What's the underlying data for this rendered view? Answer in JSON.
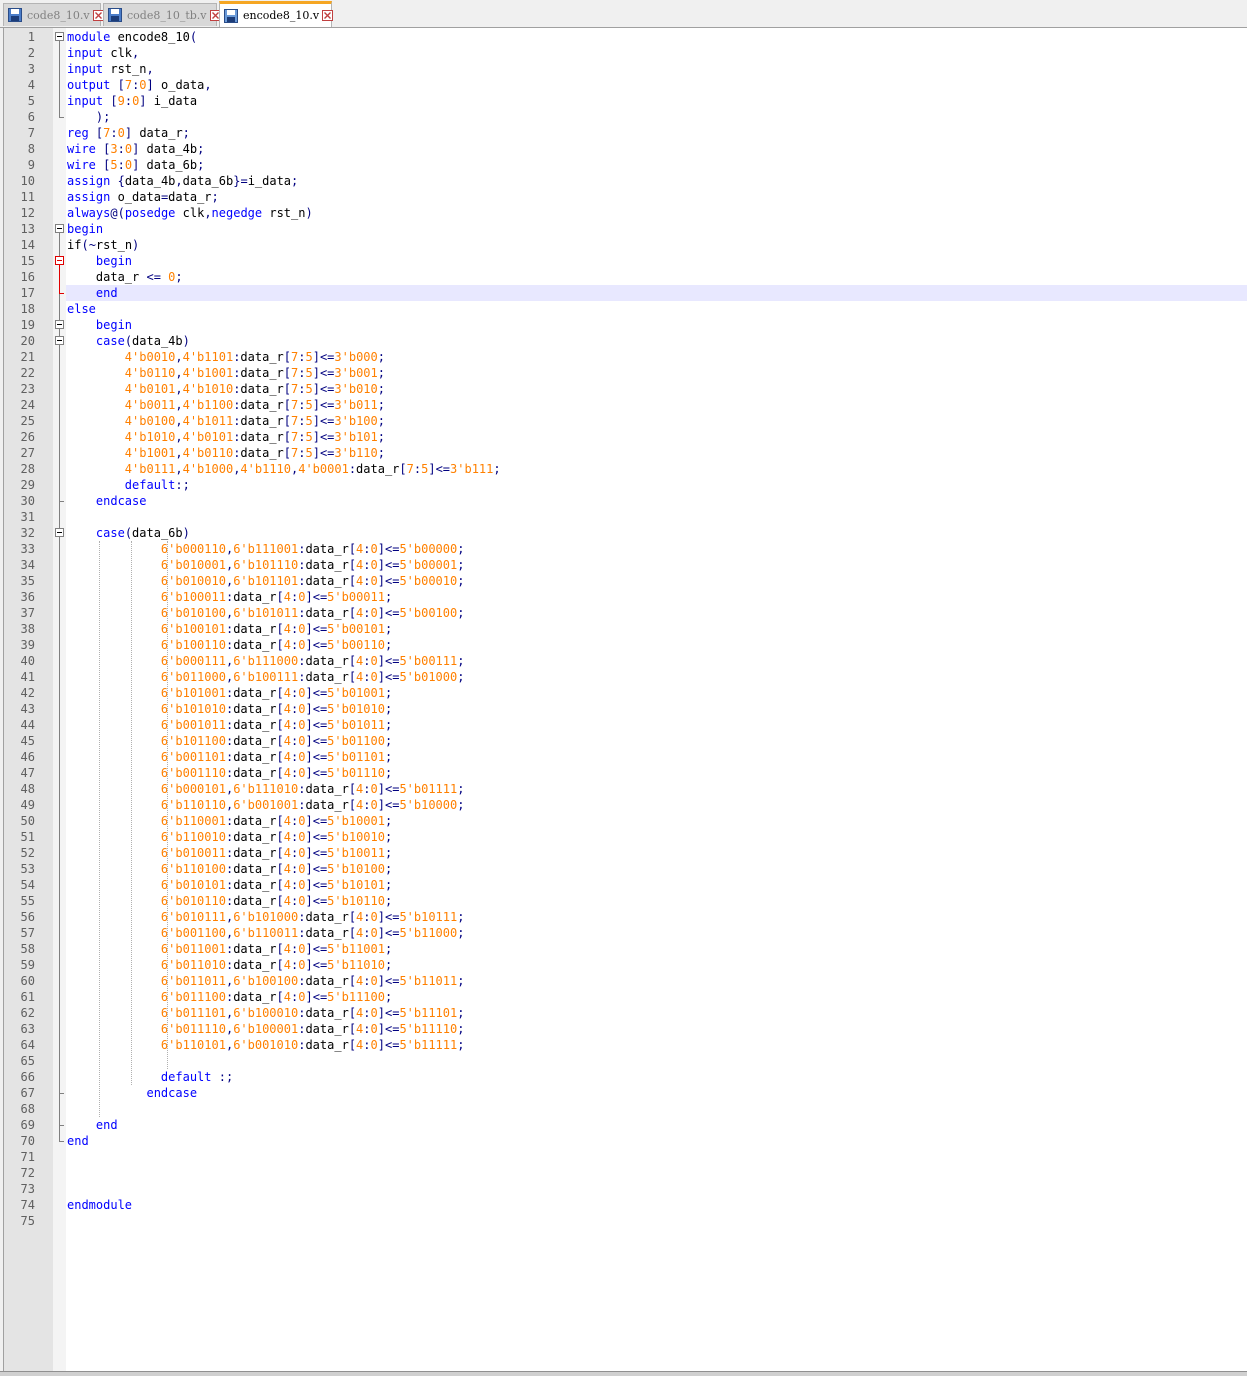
{
  "tabs": [
    {
      "label": "code8_10.v",
      "active": false
    },
    {
      "label": "code8_10_tb.v",
      "active": false
    },
    {
      "label": "encode8_10.v",
      "active": true
    }
  ],
  "editor": {
    "highlighted_line": 17,
    "lines": [
      "module encode8_10(",
      "input clk,",
      "input rst_n,",
      "output [7:0] o_data,",
      "input [9:0] i_data",
      "    );",
      "reg [7:0] data_r;",
      "wire [3:0] data_4b;",
      "wire [5:0] data_6b;",
      "assign {data_4b,data_6b}=i_data;",
      "assign o_data=data_r;",
      "always@(posedge clk,negedge rst_n)",
      "begin",
      "if(~rst_n)",
      "    begin",
      "    data_r <= 0;",
      "    end",
      "else",
      "    begin",
      "    case(data_4b)",
      "        4'b0010,4'b1101:data_r[7:5]<=3'b000;",
      "        4'b0110,4'b1001:data_r[7:5]<=3'b001;",
      "        4'b0101,4'b1010:data_r[7:5]<=3'b010;",
      "        4'b0011,4'b1100:data_r[7:5]<=3'b011;",
      "        4'b0100,4'b1011:data_r[7:5]<=3'b100;",
      "        4'b1010,4'b0101:data_r[7:5]<=3'b101;",
      "        4'b1001,4'b0110:data_r[7:5]<=3'b110;",
      "        4'b0111,4'b1000,4'b1110,4'b0001:data_r[7:5]<=3'b111;",
      "        default:;",
      "    endcase",
      "",
      "    case(data_6b)",
      "             6'b000110,6'b111001:data_r[4:0]<=5'b00000;",
      "             6'b010001,6'b101110:data_r[4:0]<=5'b00001;",
      "             6'b010010,6'b101101:data_r[4:0]<=5'b00010;",
      "             6'b100011:data_r[4:0]<=5'b00011;",
      "             6'b010100,6'b101011:data_r[4:0]<=5'b00100;",
      "             6'b100101:data_r[4:0]<=5'b00101;",
      "             6'b100110:data_r[4:0]<=5'b00110;",
      "             6'b000111,6'b111000:data_r[4:0]<=5'b00111;",
      "             6'b011000,6'b100111:data_r[4:0]<=5'b01000;",
      "             6'b101001:data_r[4:0]<=5'b01001;",
      "             6'b101010:data_r[4:0]<=5'b01010;",
      "             6'b001011:data_r[4:0]<=5'b01011;",
      "             6'b101100:data_r[4:0]<=5'b01100;",
      "             6'b001101:data_r[4:0]<=5'b01101;",
      "             6'b001110:data_r[4:0]<=5'b01110;",
      "             6'b000101,6'b111010:data_r[4:0]<=5'b01111;",
      "             6'b110110,6'b001001:data_r[4:0]<=5'b10000;",
      "             6'b110001:data_r[4:0]<=5'b10001;",
      "             6'b110010:data_r[4:0]<=5'b10010;",
      "             6'b010011:data_r[4:0]<=5'b10011;",
      "             6'b110100:data_r[4:0]<=5'b10100;",
      "             6'b010101:data_r[4:0]<=5'b10101;",
      "             6'b010110:data_r[4:0]<=5'b10110;",
      "             6'b010111,6'b101000:data_r[4:0]<=5'b10111;",
      "             6'b001100,6'b110011:data_r[4:0]<=5'b11000;",
      "             6'b011001:data_r[4:0]<=5'b11001;",
      "             6'b011010:data_r[4:0]<=5'b11010;",
      "             6'b011011,6'b100100:data_r[4:0]<=5'b11011;",
      "             6'b011100:data_r[4:0]<=5'b11100;",
      "             6'b011101,6'b100010:data_r[4:0]<=5'b11101;",
      "             6'b011110,6'b100001:data_r[4:0]<=5'b11110;",
      "             6'b110101,6'b001010:data_r[4:0]<=5'b11111;",
      "",
      "             default :;",
      "           endcase",
      "",
      "    end",
      "end",
      "",
      "",
      "",
      "endmodule",
      ""
    ]
  }
}
